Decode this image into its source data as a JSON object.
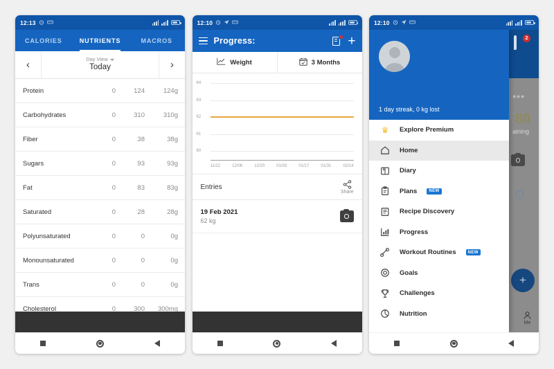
{
  "phone1": {
    "status": {
      "time": "12:13",
      "icons": [
        "alarm-icon",
        "dnd-icon",
        "signal-icon",
        "network-icon",
        "battery-icon"
      ]
    },
    "tabs": [
      {
        "label": "CALORIES",
        "active": false
      },
      {
        "label": "NUTRIENTS",
        "active": true
      },
      {
        "label": "MACROS",
        "active": false
      }
    ],
    "day_selector": {
      "prev": "‹",
      "next": "›",
      "view_label": "Day View",
      "current": "Today"
    },
    "nutrients": [
      {
        "name": "Protein",
        "c1": "0",
        "c2": "124",
        "c3": "124g"
      },
      {
        "name": "Carbohydrates",
        "c1": "0",
        "c2": "310",
        "c3": "310g"
      },
      {
        "name": "Fiber",
        "c1": "0",
        "c2": "38",
        "c3": "38g"
      },
      {
        "name": "Sugars",
        "c1": "0",
        "c2": "93",
        "c3": "93g"
      },
      {
        "name": "Fat",
        "c1": "0",
        "c2": "83",
        "c3": "83g"
      },
      {
        "name": "Saturated",
        "c1": "0",
        "c2": "28",
        "c3": "28g"
      },
      {
        "name": "Polyunsaturated",
        "c1": "0",
        "c2": "0",
        "c3": "0g"
      },
      {
        "name": "Monounsaturated",
        "c1": "0",
        "c2": "0",
        "c3": "0g"
      },
      {
        "name": "Trans",
        "c1": "0",
        "c2": "0",
        "c3": "0g"
      },
      {
        "name": "Cholesterol",
        "c1": "0",
        "c2": "300",
        "c3": "300mg"
      }
    ]
  },
  "phone2": {
    "status": {
      "time": "12:10"
    },
    "appbar": {
      "title": "Progress:",
      "menu_icon": "hamburger-icon",
      "note_icon": "document-icon",
      "add_icon": "plus-icon"
    },
    "subtabs": [
      {
        "label": "Weight",
        "icon": "line-chart-icon"
      },
      {
        "label": "3 Months",
        "icon": "calendar-icon"
      }
    ],
    "entries": {
      "header": "Entries",
      "share_label": "Share"
    },
    "entry_list": [
      {
        "date": "19 Feb 2021",
        "weight": "62 kg",
        "icon": "camera-icon"
      }
    ]
  },
  "phone3": {
    "status": {
      "time": "12:10"
    },
    "drawer": {
      "streak": "1 day streak, 0 kg lost",
      "avatar": "avatar-placeholder",
      "items": [
        {
          "label": "Explore Premium",
          "icon": "crown-icon",
          "badge": "",
          "selected": false
        },
        {
          "label": "Home",
          "icon": "home-icon",
          "badge": "",
          "selected": true
        },
        {
          "label": "Diary",
          "icon": "book-icon",
          "badge": "",
          "selected": false
        },
        {
          "label": "Plans",
          "icon": "clipboard-icon",
          "badge": "NEW",
          "selected": false
        },
        {
          "label": "Recipe Discovery",
          "icon": "recipe-icon",
          "badge": "",
          "selected": false
        },
        {
          "label": "Progress",
          "icon": "bar-chart-icon",
          "badge": "",
          "selected": false
        },
        {
          "label": "Workout Routines",
          "icon": "dumbbell-icon",
          "badge": "NEW",
          "selected": false
        },
        {
          "label": "Goals",
          "icon": "target-icon",
          "badge": "",
          "selected": false
        },
        {
          "label": "Challenges",
          "icon": "trophy-icon",
          "badge": "",
          "selected": false
        },
        {
          "label": "Nutrition",
          "icon": "pie-chart-icon",
          "badge": "",
          "selected": false
        }
      ]
    },
    "background": {
      "chat_badge": "2",
      "overflow": "•••",
      "calories": "80",
      "remaining": "aining",
      "me_label": "Me"
    }
  },
  "chart_data": {
    "type": "line",
    "title": "Weight",
    "xlabel": "",
    "ylabel": "",
    "ylim": [
      60,
      64
    ],
    "yticks": [
      "64",
      "63",
      "62",
      "61",
      "60"
    ],
    "xticks": [
      "11/22",
      "12/06",
      "12/20",
      "01/03",
      "01/17",
      "01/31",
      "02/14"
    ],
    "series": [
      {
        "name": "Weight (kg)",
        "color": "#e8a33d",
        "constant_value": 62
      }
    ],
    "grid": true,
    "legend": "none"
  },
  "colors": {
    "primary": "#1565c0",
    "status_bar": "#0f55a8",
    "accent_line": "#e8a33d",
    "badge_red": "#d32f2f",
    "new_badge": "#1976d2",
    "crown_gold": "#f2c02e"
  },
  "navbar": {
    "recents": "square-icon",
    "home": "circle-icon",
    "back": "triangle-icon"
  }
}
